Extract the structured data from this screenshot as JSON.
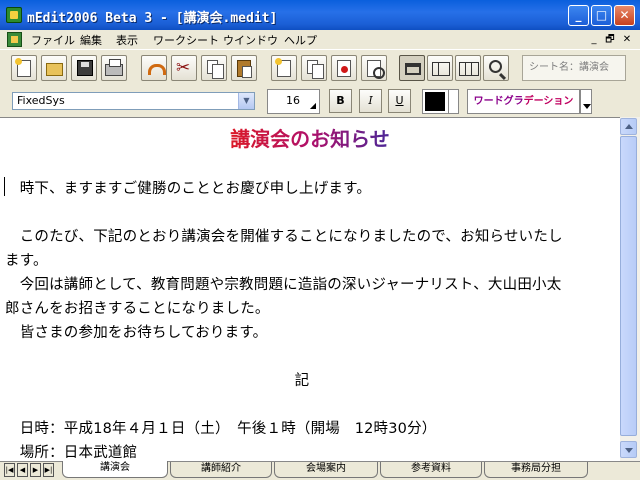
{
  "window": {
    "title": "mEdit2006 Beta 3 - [講演会.medit]",
    "minimize_label": "_",
    "maximize_label": "□",
    "close_label": "✕"
  },
  "menu": {
    "items": [
      "ファイル",
      "編集",
      "表示",
      "ワークシート",
      "ウインドウ",
      "ヘルプ"
    ],
    "mdi_minimize": "_",
    "mdi_restore": "🗗",
    "mdi_close": "✕"
  },
  "toolbar": {
    "sheet_name_placeholder": "シート名：講演会",
    "icons": [
      "new-doc-icon",
      "open-folder-icon",
      "save-disk-icon",
      "print-icon",
      "undo-icon",
      "cut-scissors-icon",
      "copy-icon",
      "paste-icon",
      "new-sheet-icon",
      "copy-sheet-icon",
      "delete-sheet-icon",
      "print-preview-icon",
      "single-view-icon",
      "two-column-view-icon",
      "three-column-view-icon",
      "zoom-icon"
    ]
  },
  "format": {
    "font_name": "FixedSys",
    "font_size": "16",
    "bold_label": "B",
    "italic_label": "I",
    "underline_label": "U",
    "text_color": "#000000",
    "gradient_label_a": "ワードグラ",
    "gradient_label_b": "デーション"
  },
  "document": {
    "heading": "講演会のお知らせ",
    "heading_colors": [
      "#e21b1b",
      "#3a2a9e"
    ],
    "lines": [
      "　時下、ますますご健勝のこととお慶び申し上げます。",
      "",
      "　このたび、下記のとおり講演会を開催することになりましたので、お知らせいたし",
      "ます。",
      "　今回は講師として、教育問題や宗教問題に造詣の深いジャーナリスト、大山田小太",
      "郎さんをお招きすることになりました。",
      "　皆さまの参加をお待ちしております。",
      "",
      "記",
      "",
      "　日時：平成18年４月１日（土）　午後１時（開場　12時30分）",
      "　場所：日本武道館"
    ]
  },
  "tabs": {
    "nav": [
      "|◀",
      "◀",
      "▶",
      "▶|"
    ],
    "items": [
      "講演会",
      "講師紹介",
      "会場案内",
      "参考資料",
      "事務局分担"
    ],
    "active_index": 0
  }
}
